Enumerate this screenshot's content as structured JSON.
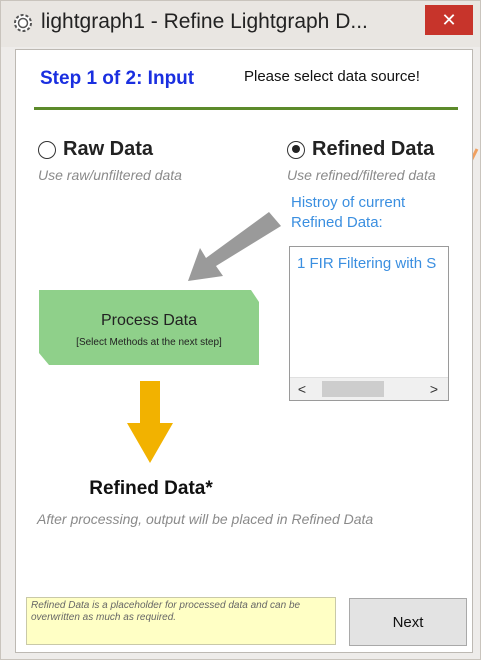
{
  "window": {
    "title": "lightgraph1 - Refine Lightgraph D...",
    "close_label": "✕"
  },
  "header": {
    "step_title": "Step 1 of 2: Input",
    "hint": "Please select data source!"
  },
  "sources": {
    "raw": {
      "label": "Raw Data",
      "sub": "Use raw/unfiltered data",
      "selected": false
    },
    "refined": {
      "label": "Refined Data",
      "sub": "Use refined/filtered data",
      "selected": true
    }
  },
  "history": {
    "label": "Histroy of current Refined Data:",
    "items": [
      "1 FIR Filtering with S"
    ],
    "scroll_left": "<",
    "scroll_right": ">"
  },
  "process": {
    "title": "Process Data",
    "sub": "[Select Methods at the next step]"
  },
  "output": {
    "title": "Refined Data*",
    "sub": "After processing, output will be placed in Refined Data"
  },
  "note": "Refined Data is a placeholder for processed data and can be overwritten as much as required.",
  "next_label": "Next",
  "colors": {
    "step_title": "#1a2fe0",
    "history": "#3b8fe0",
    "rule": "#5c8a2a",
    "process_fill": "#8fd08a",
    "arrow_orange": "#f2b200",
    "close": "#c7342b",
    "pointer": "#f0a060"
  }
}
